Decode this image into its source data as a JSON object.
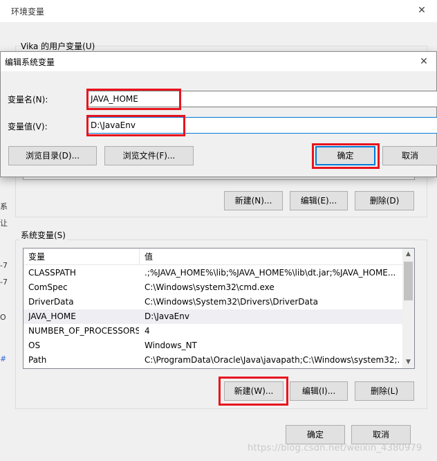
{
  "env_window": {
    "title": "环境变量",
    "close_glyph": "✕",
    "user_group_label": "Vika 的用户变量(U)",
    "user_buttons": {
      "new": "新建(N)...",
      "edit": "编辑(E)...",
      "delete": "删除(D)"
    },
    "system_group_label": "系统变量(S)",
    "system_table": {
      "columns": [
        "变量",
        "值"
      ],
      "rows": [
        {
          "name": "CLASSPATH",
          "value": ".;%JAVA_HOME%\\lib;%JAVA_HOME%\\lib\\dt.jar;%JAVA_HOME..."
        },
        {
          "name": "ComSpec",
          "value": "C:\\Windows\\system32\\cmd.exe"
        },
        {
          "name": "DriverData",
          "value": "C:\\Windows\\System32\\Drivers\\DriverData"
        },
        {
          "name": "JAVA_HOME",
          "value": "D:\\JavaEnv"
        },
        {
          "name": "NUMBER_OF_PROCESSORS",
          "value": "4"
        },
        {
          "name": "OS",
          "value": "Windows_NT"
        },
        {
          "name": "Path",
          "value": "C:\\ProgramData\\Oracle\\Java\\javapath;C:\\Windows\\system32;..."
        }
      ]
    },
    "system_buttons": {
      "new": "新建(W)...",
      "edit": "编辑(I)...",
      "delete": "删除(L)"
    },
    "ok": "确定",
    "cancel": "取消",
    "edge_text": [
      "系",
      "让",
      "-7",
      "-7",
      "O",
      "#"
    ]
  },
  "edit_dialog": {
    "title": "编辑系统变量",
    "close_glyph": "✕",
    "name_label": "变量名(N):",
    "value_label": "变量值(V):",
    "name_value": "JAVA_HOME",
    "value_value": "D:\\JavaEnv",
    "browse_dir": "浏览目录(D)...",
    "browse_file": "浏览文件(F)...",
    "ok": "确定",
    "cancel": "取消"
  },
  "watermark": "https://blog.csdn.net/weixin_4380979",
  "highlight_color": "#e8141e",
  "accent_color": "#0078d7"
}
